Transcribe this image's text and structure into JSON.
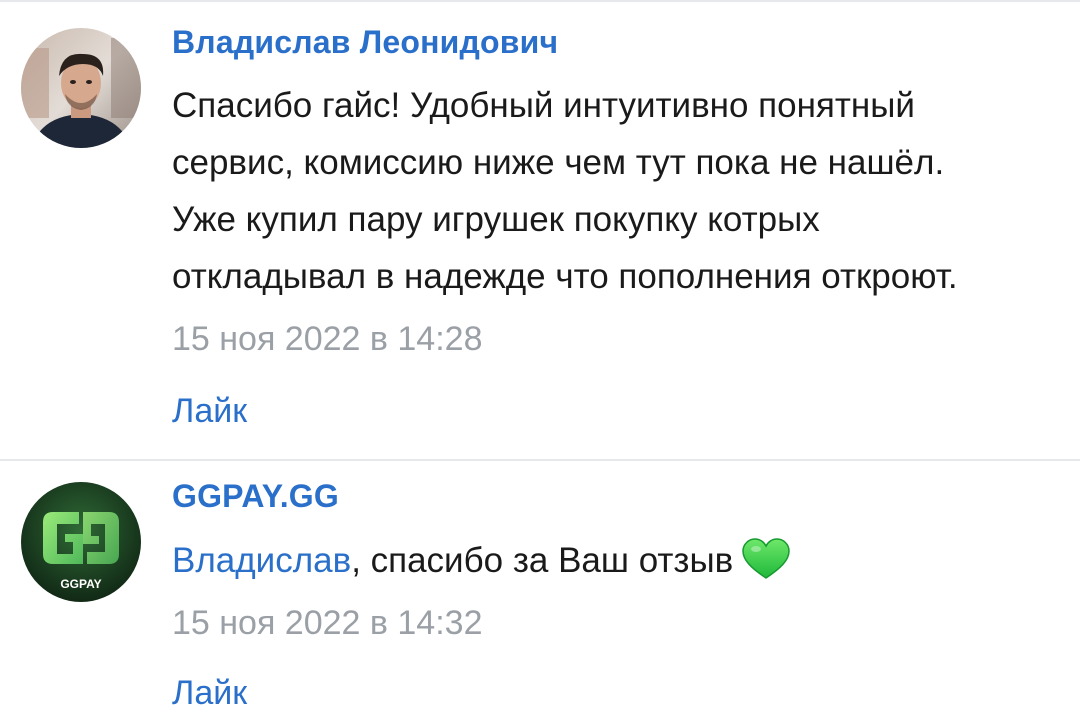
{
  "comments": [
    {
      "author": "Владислав Леонидович",
      "avatar_icon": "user-photo-avatar",
      "text_lines": [
        "Спасибо гайс! Удобный интуитивно понятный",
        "сервис, комиссию ниже чем тут пока не нашёл.",
        "Уже купил пару игрушек покупку котрых",
        "откладывал в надежде что пополнения откроют."
      ],
      "date": "15 ноя 2022 в 14:28",
      "like_label": "Лайк"
    },
    {
      "author": "GGPAY.GG",
      "avatar_icon": "ggpay-logo-avatar",
      "avatar_text": "GGPAY",
      "mention": "Владислав",
      "text": ", спасибо за Ваш отзыв",
      "emoji_icon": "green-heart-icon",
      "date": "15 ноя 2022 в 14:32",
      "like_label": "Лайк"
    }
  ],
  "colors": {
    "link": "#2a6fc9",
    "text": "#1a1a1a",
    "muted": "#9aa0a6",
    "divider": "#e7e8ec",
    "heart": "#32d14a"
  }
}
